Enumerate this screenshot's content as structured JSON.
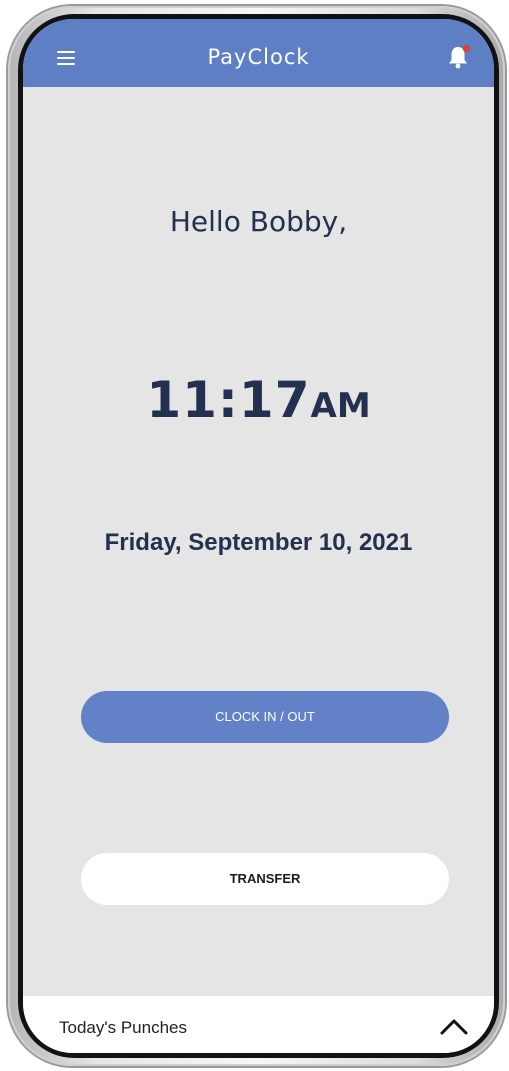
{
  "header": {
    "title": "PayClock",
    "menu_icon": "hamburger-menu-icon",
    "bell_icon": "bell-icon",
    "notification_dot_color": "#e0412a",
    "bar_color": "#5f7fc4"
  },
  "main": {
    "greeting": "Hello Bobby,",
    "time": "11:17",
    "ampm": "AM",
    "date": "Friday, September 10, 2021"
  },
  "actions": {
    "clock_label": "CLOCK IN / OUT",
    "clock_color": "#6381c6",
    "transfer_label": "TRANSFER"
  },
  "bottom": {
    "label": "Today's Punches",
    "chevron_icon": "chevron-up-icon"
  }
}
